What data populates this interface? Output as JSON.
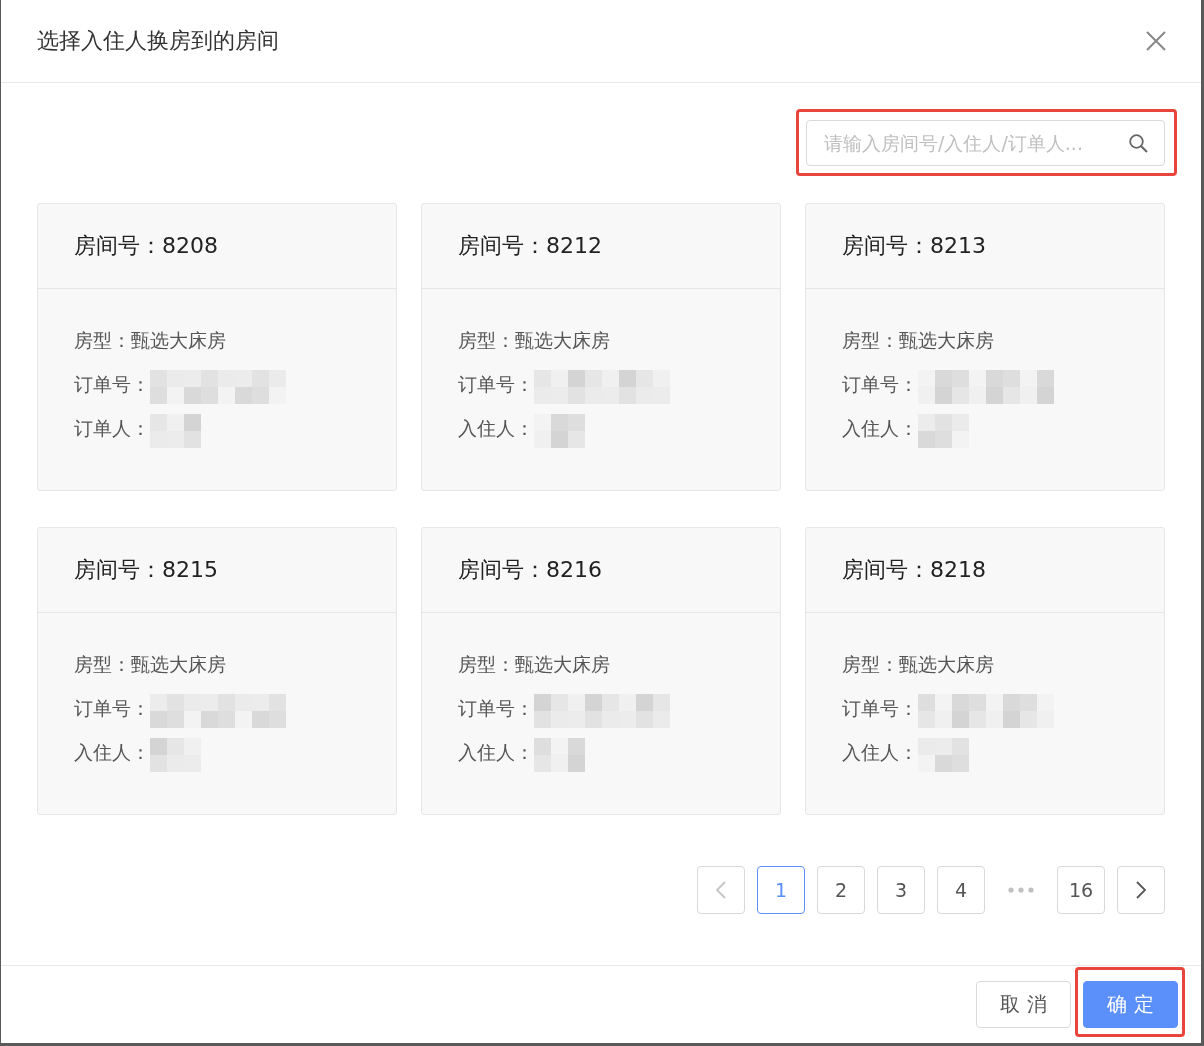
{
  "dialog": {
    "title": "选择入住人换房到的房间"
  },
  "search": {
    "placeholder": "请输入房间号/入住人/订单人...",
    "highlighted": true
  },
  "rooms": [
    {
      "title": "房间号：8208",
      "fields": [
        {
          "label": "房型：",
          "value": "甄选大床房"
        },
        {
          "label": "订单号：",
          "redacted": true
        },
        {
          "label": "订单人：",
          "redacted": true
        }
      ]
    },
    {
      "title": "房间号：8212",
      "fields": [
        {
          "label": "房型：",
          "value": "甄选大床房"
        },
        {
          "label": "订单号：",
          "redacted": true
        },
        {
          "label": "入住人：",
          "redacted": true
        }
      ]
    },
    {
      "title": "房间号：8213",
      "fields": [
        {
          "label": "房型：",
          "value": "甄选大床房"
        },
        {
          "label": "订单号：",
          "redacted": true
        },
        {
          "label": "入住人：",
          "redacted": true
        }
      ]
    },
    {
      "title": "房间号：8215",
      "fields": [
        {
          "label": "房型：",
          "value": "甄选大床房"
        },
        {
          "label": "订单号：",
          "redacted": true
        },
        {
          "label": "入住人：",
          "redacted": true
        }
      ]
    },
    {
      "title": "房间号：8216",
      "fields": [
        {
          "label": "房型：",
          "value": "甄选大床房"
        },
        {
          "label": "订单号：",
          "redacted": true
        },
        {
          "label": "入住人：",
          "redacted": true
        }
      ]
    },
    {
      "title": "房间号：8218",
      "fields": [
        {
          "label": "房型：",
          "value": "甄选大床房"
        },
        {
          "label": "订单号：",
          "redacted": true
        },
        {
          "label": "入住人：",
          "redacted": true
        }
      ]
    }
  ],
  "pagination": {
    "prev": {
      "disabled": true
    },
    "next": {
      "disabled": false
    },
    "items": [
      {
        "kind": "page",
        "label": "1",
        "selected": true
      },
      {
        "kind": "page",
        "label": "2",
        "selected": false
      },
      {
        "kind": "page",
        "label": "3",
        "selected": false
      },
      {
        "kind": "page",
        "label": "4",
        "selected": false
      },
      {
        "kind": "ellipsis"
      },
      {
        "kind": "page",
        "label": "16",
        "selected": false
      }
    ]
  },
  "footer": {
    "buttons": [
      {
        "kind": "default",
        "label": "取 消",
        "highlighted": false
      },
      {
        "kind": "primary",
        "label": "确 定",
        "highlighted": true
      }
    ]
  }
}
